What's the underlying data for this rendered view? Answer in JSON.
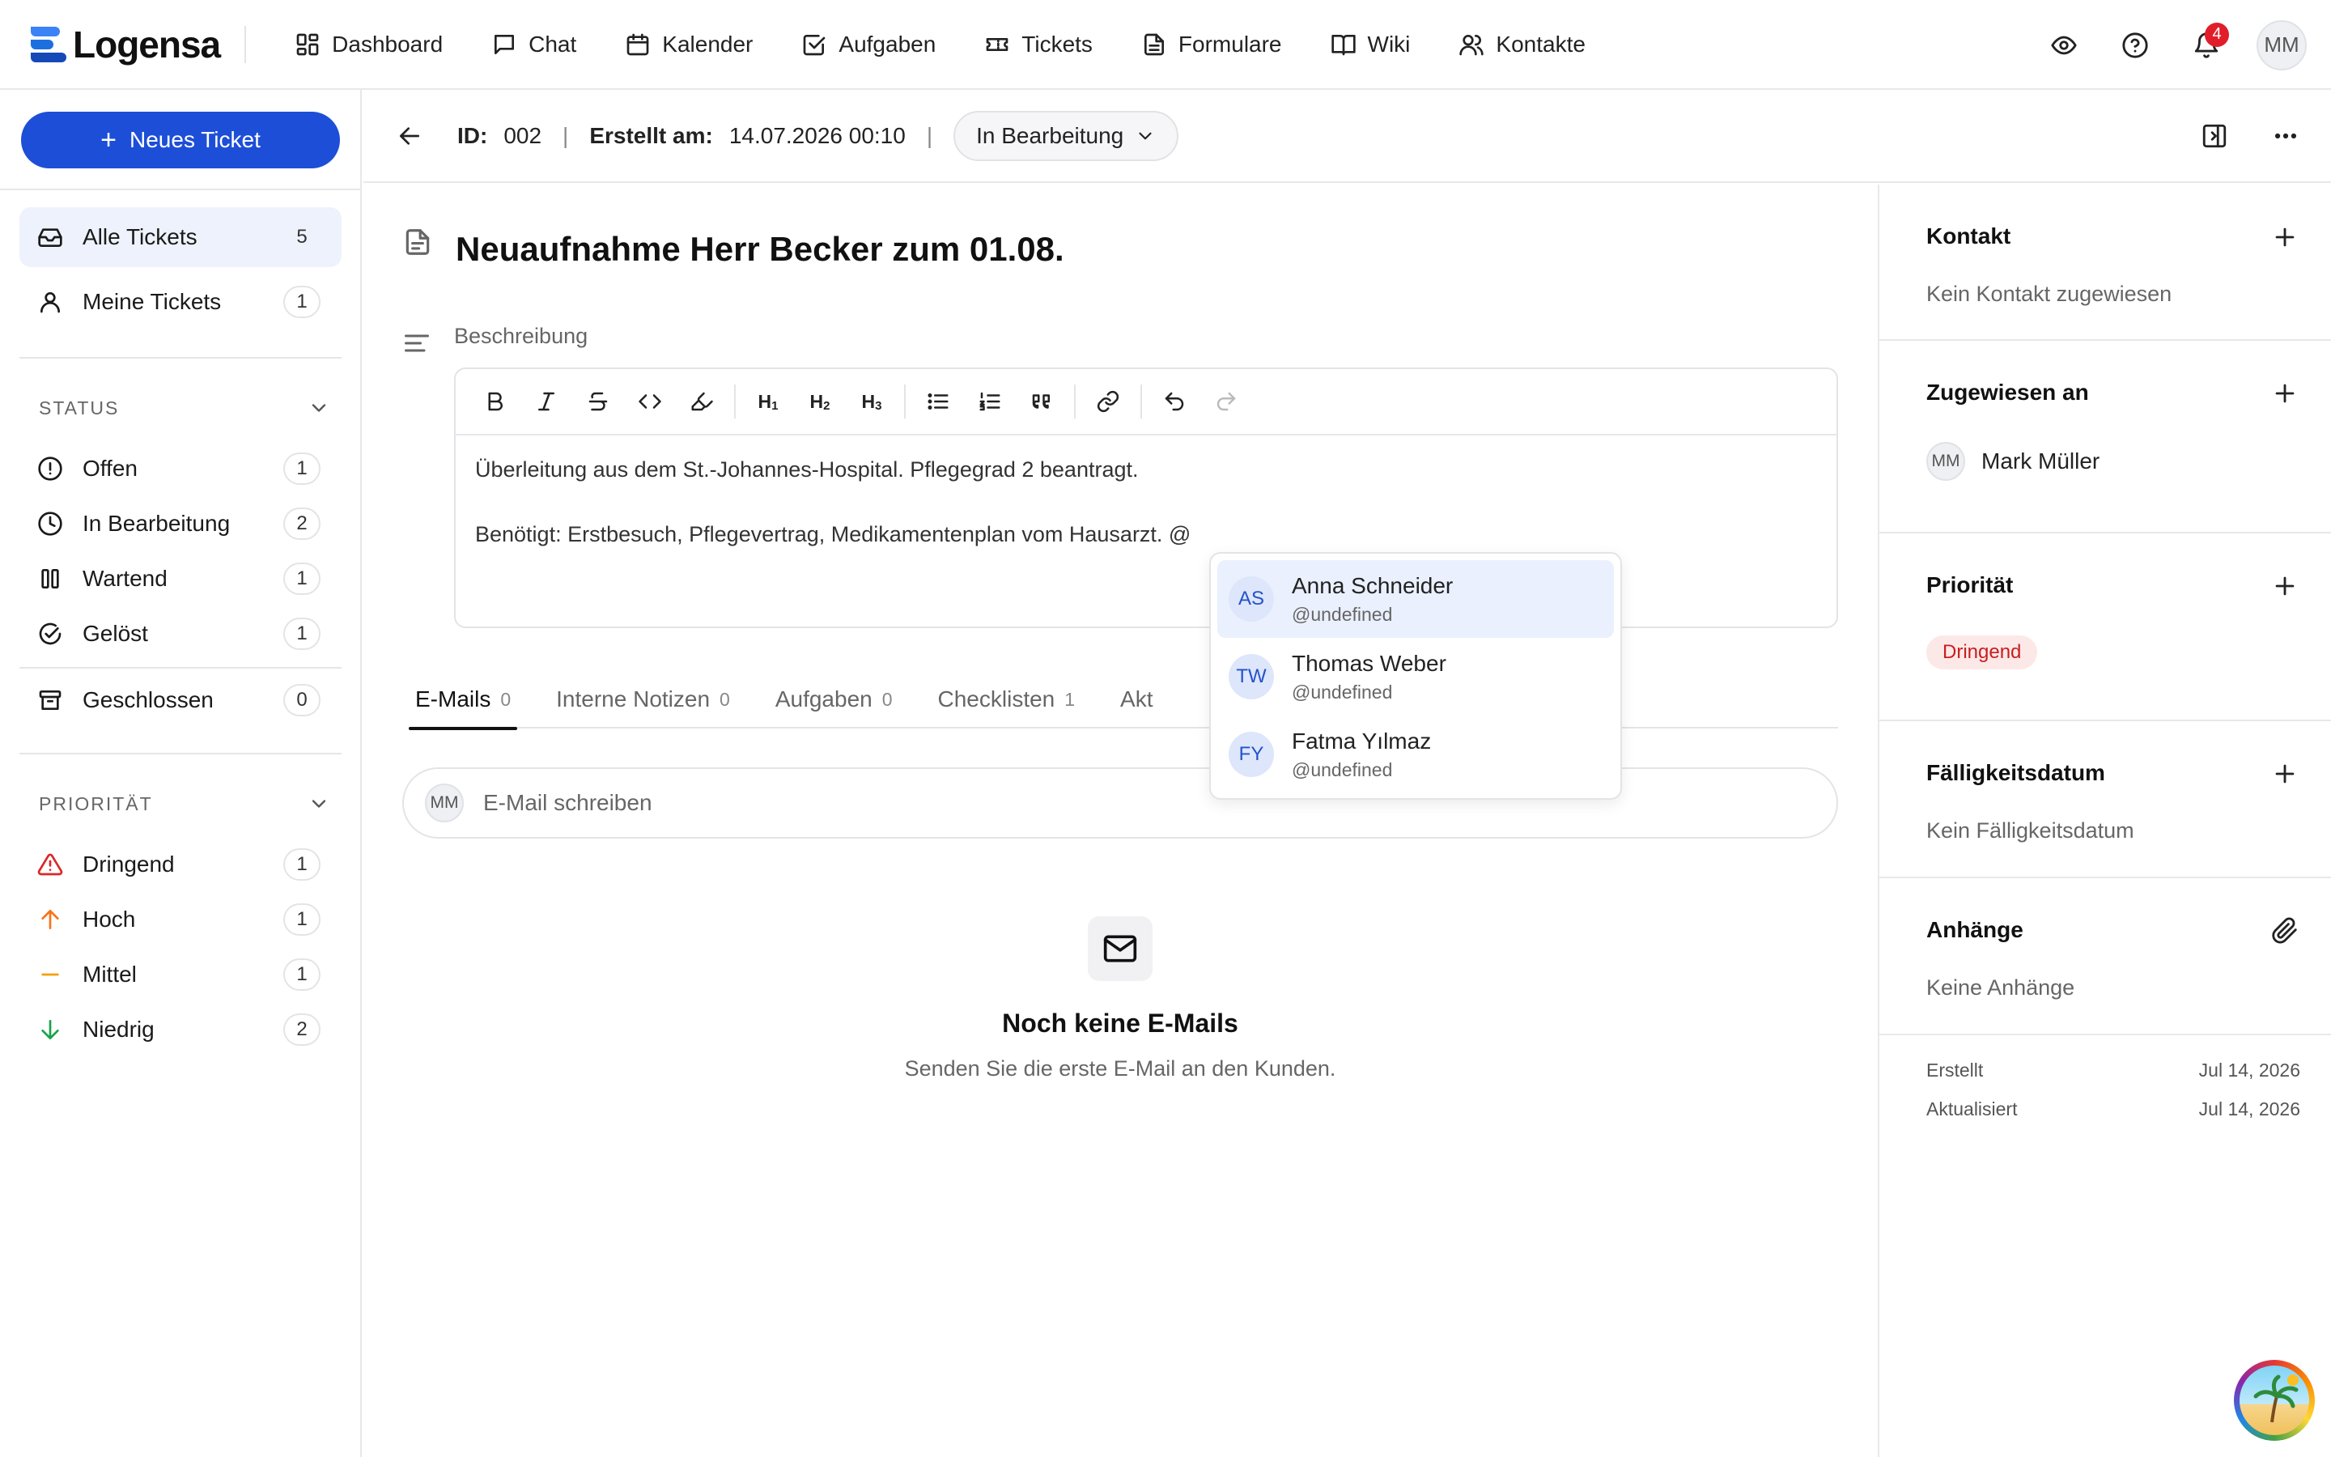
{
  "app": {
    "name": "Logensa"
  },
  "nav": [
    {
      "label": "Dashboard",
      "icon": "dashboard-icon"
    },
    {
      "label": "Chat",
      "icon": "chat-icon"
    },
    {
      "label": "Kalender",
      "icon": "calendar-icon"
    },
    {
      "label": "Aufgaben",
      "icon": "checkbox-icon"
    },
    {
      "label": "Tickets",
      "icon": "ticket-icon"
    },
    {
      "label": "Formulare",
      "icon": "form-icon"
    },
    {
      "label": "Wiki",
      "icon": "book-icon"
    },
    {
      "label": "Kontakte",
      "icon": "contacts-icon"
    }
  ],
  "topright": {
    "notification_count": "4",
    "user_initials": "MM"
  },
  "sidebar": {
    "new_ticket_label": "Neues Ticket",
    "views": [
      {
        "label": "Alle Tickets",
        "count": "5",
        "icon": "inbox-icon"
      },
      {
        "label": "Meine Tickets",
        "count": "1",
        "icon": "user-icon"
      }
    ],
    "status_heading": "STATUS",
    "status": [
      {
        "label": "Offen",
        "count": "1",
        "icon": "alert-circle-icon"
      },
      {
        "label": "In Bearbeitung",
        "count": "2",
        "icon": "clock-icon"
      },
      {
        "label": "Wartend",
        "count": "1",
        "icon": "pause-icon"
      },
      {
        "label": "Gelöst",
        "count": "1",
        "icon": "check-circle-icon"
      },
      {
        "label": "Geschlossen",
        "count": "0",
        "icon": "archive-icon"
      }
    ],
    "priority_heading": "PRIORITÄT",
    "priority": [
      {
        "label": "Dringend",
        "count": "1",
        "icon": "warning-triangle-icon",
        "color": "#dc2626"
      },
      {
        "label": "Hoch",
        "count": "1",
        "icon": "arrow-up-icon",
        "color": "#f97316"
      },
      {
        "label": "Mittel",
        "count": "1",
        "icon": "minus-icon",
        "color": "#f59e0b"
      },
      {
        "label": "Niedrig",
        "count": "2",
        "icon": "arrow-down-icon",
        "color": "#16a34a"
      }
    ]
  },
  "ticket": {
    "id_label": "ID:",
    "id": "002",
    "created_label": "Erstellt am:",
    "created": "14.07.2026 00:10",
    "status": "In Bearbeitung",
    "title": "Neuaufnahme Herr Becker zum 01.08.",
    "description_label": "Beschreibung",
    "description_lines": [
      "Überleitung aus dem St.-Johannes-Hospital. Pflegegrad 2 beantragt.",
      "",
      "Benötigt: Erstbesuch, Pflegevertrag, Medikamentenplan vom Hausarzt. @"
    ]
  },
  "toolbar": {
    "h1": "H",
    "h1_sub": "1",
    "h2": "H",
    "h2_sub": "2",
    "h3": "H",
    "h3_sub": "3"
  },
  "mentions": [
    {
      "initials": "AS",
      "name": "Anna Schneider",
      "handle": "@undefined"
    },
    {
      "initials": "TW",
      "name": "Thomas Weber",
      "handle": "@undefined"
    },
    {
      "initials": "FY",
      "name": "Fatma Yılmaz",
      "handle": "@undefined"
    }
  ],
  "tabs": [
    {
      "label": "E-Mails",
      "count": "0"
    },
    {
      "label": "Interne Notizen",
      "count": "0"
    },
    {
      "label": "Aufgaben",
      "count": "0"
    },
    {
      "label": "Checklisten",
      "count": "1"
    },
    {
      "label": "Akt",
      "count": ""
    }
  ],
  "compose": {
    "initials": "MM",
    "placeholder": "E-Mail schreiben"
  },
  "empty": {
    "title": "Noch keine E-Mails",
    "subtitle": "Senden Sie die erste E-Mail an den Kunden."
  },
  "right": {
    "contact_heading": "Kontakt",
    "contact_empty": "Kein Kontakt zugewiesen",
    "assigned_heading": "Zugewiesen an",
    "assignee_initials": "MM",
    "assignee_name": "Mark Müller",
    "priority_heading": "Priorität",
    "priority_value": "Dringend",
    "due_heading": "Fälligkeitsdatum",
    "due_empty": "Kein Fälligkeitsdatum",
    "attachments_heading": "Anhänge",
    "attachments_empty": "Keine Anhänge",
    "created_label": "Erstellt",
    "created_value": "Jul 14, 2026",
    "updated_label": "Aktualisiert",
    "updated_value": "Jul 14, 2026"
  },
  "colors": {
    "accent": "#1d4ed8",
    "urgent": "#c81e1e"
  }
}
